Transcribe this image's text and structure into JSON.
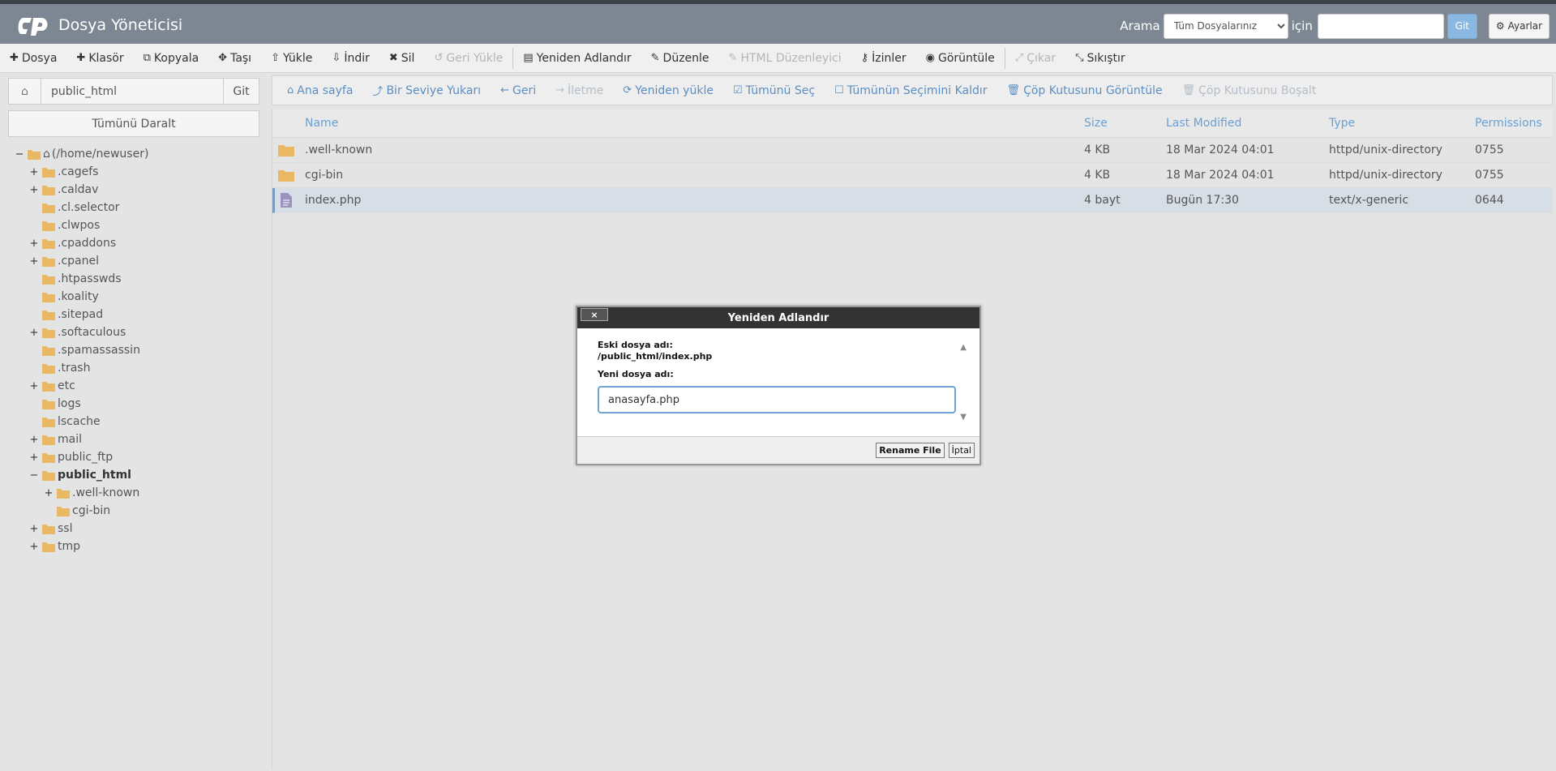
{
  "header": {
    "app_title": "Dosya Yöneticisi",
    "search_label": "Arama",
    "search_scope": "Tüm Dosyalarınız",
    "search_for": "için",
    "search_value": "",
    "go_label": "Git",
    "settings_label": "Ayarlar"
  },
  "toolbar": {
    "items": [
      {
        "label": "Dosya",
        "icon": "plus-icon"
      },
      {
        "label": "Klasör",
        "icon": "plus-icon"
      },
      {
        "label": "Kopyala",
        "icon": "copy-icon"
      },
      {
        "label": "Taşı",
        "icon": "move-icon"
      },
      {
        "label": "Yükle",
        "icon": "upload-icon"
      },
      {
        "label": "İndir",
        "icon": "download-icon"
      },
      {
        "label": "Sil",
        "icon": "x-icon"
      },
      {
        "label": "Geri Yükle",
        "icon": "undo-icon"
      },
      {
        "label": "Yeniden Adlandır",
        "icon": "file-icon"
      },
      {
        "label": "Düzenle",
        "icon": "pencil-icon"
      },
      {
        "label": "HTML Düzenleyici",
        "icon": "edit-icon"
      },
      {
        "label": "İzinler",
        "icon": "key-icon"
      },
      {
        "label": "Görüntüle",
        "icon": "eye-icon"
      },
      {
        "label": "Çıkar",
        "icon": "expand-icon"
      },
      {
        "label": "Sıkıştır",
        "icon": "compress-icon"
      }
    ]
  },
  "left": {
    "path_value": "public_html",
    "go_label": "Git",
    "collapse_label": "Tümünü Daralt",
    "tree": [
      {
        "label": "(/home/newuser)",
        "toggle": "−"
      },
      {
        "label": ".cagefs",
        "toggle": "+"
      },
      {
        "label": ".caldav",
        "toggle": "+"
      },
      {
        "label": ".cl.selector",
        "toggle": ""
      },
      {
        "label": ".clwpos",
        "toggle": ""
      },
      {
        "label": ".cpaddons",
        "toggle": "+"
      },
      {
        "label": ".cpanel",
        "toggle": "+"
      },
      {
        "label": ".htpasswds",
        "toggle": ""
      },
      {
        "label": ".koality",
        "toggle": ""
      },
      {
        "label": ".sitepad",
        "toggle": ""
      },
      {
        "label": ".softaculous",
        "toggle": "+"
      },
      {
        "label": ".spamassassin",
        "toggle": ""
      },
      {
        "label": ".trash",
        "toggle": ""
      },
      {
        "label": "etc",
        "toggle": "+"
      },
      {
        "label": "logs",
        "toggle": ""
      },
      {
        "label": "lscache",
        "toggle": ""
      },
      {
        "label": "mail",
        "toggle": "+"
      },
      {
        "label": "public_ftp",
        "toggle": "+"
      },
      {
        "label": "public_html",
        "toggle": "−"
      },
      {
        "label": ".well-known",
        "toggle": "+"
      },
      {
        "label": "cgi-bin",
        "toggle": ""
      },
      {
        "label": "ssl",
        "toggle": "+"
      },
      {
        "label": "tmp",
        "toggle": "+"
      }
    ]
  },
  "nav": {
    "items": [
      {
        "label": "Ana sayfa",
        "icon": "home-icon"
      },
      {
        "label": "Bir Seviye Yukarı",
        "icon": "level-up-icon"
      },
      {
        "label": "Geri",
        "icon": "arrow-left-icon"
      },
      {
        "label": "İletme",
        "icon": "arrow-right-icon"
      },
      {
        "label": "Yeniden yükle",
        "icon": "refresh-icon"
      },
      {
        "label": "Tümünü Seç",
        "icon": "checkbox-checked-icon"
      },
      {
        "label": "Tümünün Seçimini Kaldır",
        "icon": "checkbox-icon"
      },
      {
        "label": "Çöp Kutusunu Görüntüle",
        "icon": "trash-icon"
      },
      {
        "label": "Çöp Kutusunu Boşalt",
        "icon": "trash-icon"
      }
    ]
  },
  "files": {
    "columns": [
      "Name",
      "Size",
      "Last Modified",
      "Type",
      "Permissions"
    ],
    "rows": [
      {
        "name": ".well-known",
        "size": "4 KB",
        "modified": "18 Mar 2024 04:01",
        "type": "httpd/unix-directory",
        "perm": "0755",
        "icon": "folder-icon"
      },
      {
        "name": "cgi-bin",
        "size": "4 KB",
        "modified": "18 Mar 2024 04:01",
        "type": "httpd/unix-directory",
        "perm": "0755",
        "icon": "folder-icon"
      },
      {
        "name": "index.php",
        "size": "4 bayt",
        "modified": "Bugün 17:30",
        "type": "text/x-generic",
        "perm": "0644",
        "icon": "file-icon"
      }
    ]
  },
  "dialog": {
    "title": "Yeniden Adlandır",
    "close_label": "×",
    "old_label": "Eski dosya adı:",
    "old_value": "/public_html/index.php",
    "new_label": "Yeni dosya adı:",
    "new_value": "anasayfa.php",
    "rename_button": "Rename File",
    "cancel_button": "İptal"
  },
  "colors": {
    "header_bg": "#7d8793",
    "link_blue": "#5b8ec2",
    "folder": "#e8b865"
  }
}
